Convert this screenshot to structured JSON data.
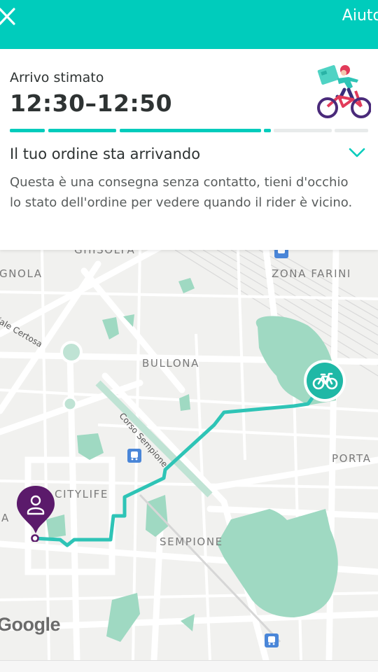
{
  "header": {
    "close_icon": "close-icon",
    "help_label": "Aiuto",
    "color": "#00ccbc"
  },
  "delivery": {
    "eta_label": "Arrivo stimato",
    "eta_value": "12:30–12:50",
    "rider_icon": "rider-on-bike-illustration",
    "progress_segments": [
      1,
      1,
      1,
      1,
      0,
      0
    ],
    "status_title": "Il tuo ordine sta arrivando",
    "status_description": "Questa è una consegna senza contatto, tieni d'occhio lo stato dell'ordine per vedere quando il rider è vicino.",
    "expand_icon": "chevron-down-icon"
  },
  "map": {
    "areas": {
      "ghisolfa": "GHISOLFA",
      "gnola": "GNOLA",
      "zona_farini": "ZONA FARINI",
      "bullona": "BULLONA",
      "porta": "PORTA",
      "citylife": "CITYLIFE",
      "a": "A",
      "sempione": "SEMPIONE"
    },
    "streets": {
      "viale_certosa": "Viale Certosa",
      "corso_sempione": "Corso Sempione"
    },
    "route_color": "#2ec4b6",
    "rider_marker_icon": "bicycle-icon",
    "destination_icon": "user-pin-icon",
    "logo": "Google"
  }
}
